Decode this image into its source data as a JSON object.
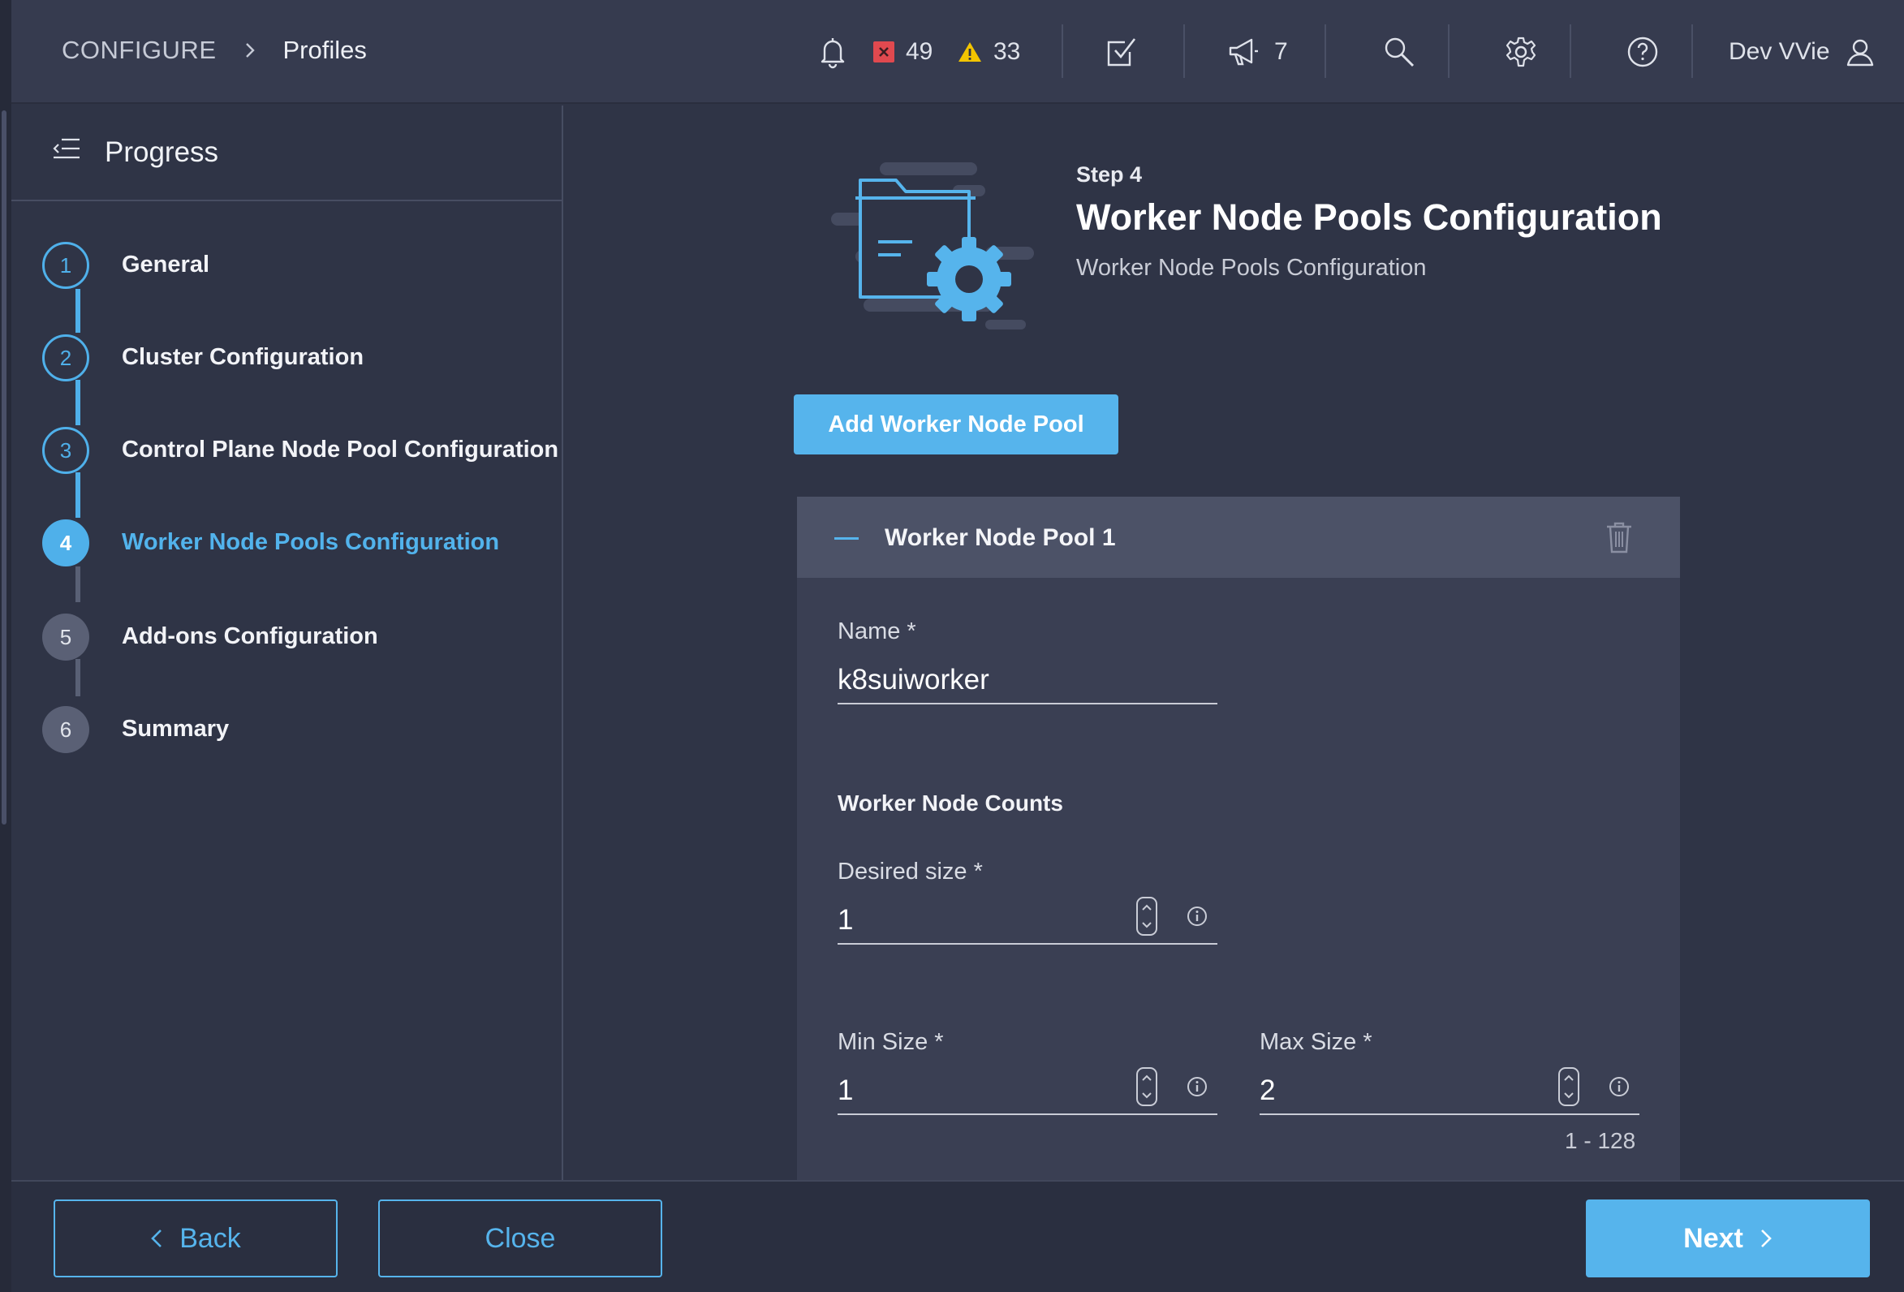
{
  "breadcrumb": {
    "root": "CONFIGURE",
    "current": "Profiles"
  },
  "topbar": {
    "critical_count": "49",
    "warning_count": "33",
    "announcements_count": "7",
    "user_name": "Dev VVie"
  },
  "progress": {
    "title": "Progress",
    "steps": [
      {
        "number": "1",
        "label": "General",
        "state": "done"
      },
      {
        "number": "2",
        "label": "Cluster Configuration",
        "state": "done"
      },
      {
        "number": "3",
        "label": "Control Plane Node Pool Configuration",
        "state": "done"
      },
      {
        "number": "4",
        "label": "Worker Node Pools Configuration",
        "state": "active"
      },
      {
        "number": "5",
        "label": "Add-ons Configuration",
        "state": "todo"
      },
      {
        "number": "6",
        "label": "Summary",
        "state": "todo"
      }
    ]
  },
  "main": {
    "step_kicker": "Step 4",
    "step_title": "Worker Node Pools Configuration",
    "step_subtitle": "Worker Node Pools Configuration",
    "add_button_label": "Add Worker Node Pool",
    "pool": {
      "title": "Worker Node Pool 1",
      "name_label": "Name *",
      "name_value": "k8suiworker",
      "counts_title": "Worker Node Counts",
      "desired_label": "Desired size *",
      "desired_value": "1",
      "min_label": "Min Size *",
      "min_value": "1",
      "max_label": "Max Size *",
      "max_value": "2",
      "range_hint": "1 - 128"
    }
  },
  "footer": {
    "back_label": "Back",
    "close_label": "Close",
    "next_label": "Next"
  },
  "colors": {
    "accent": "#56b4ec",
    "background": "#2f3446",
    "critical": "#e0494f",
    "warning": "#f2c400"
  }
}
